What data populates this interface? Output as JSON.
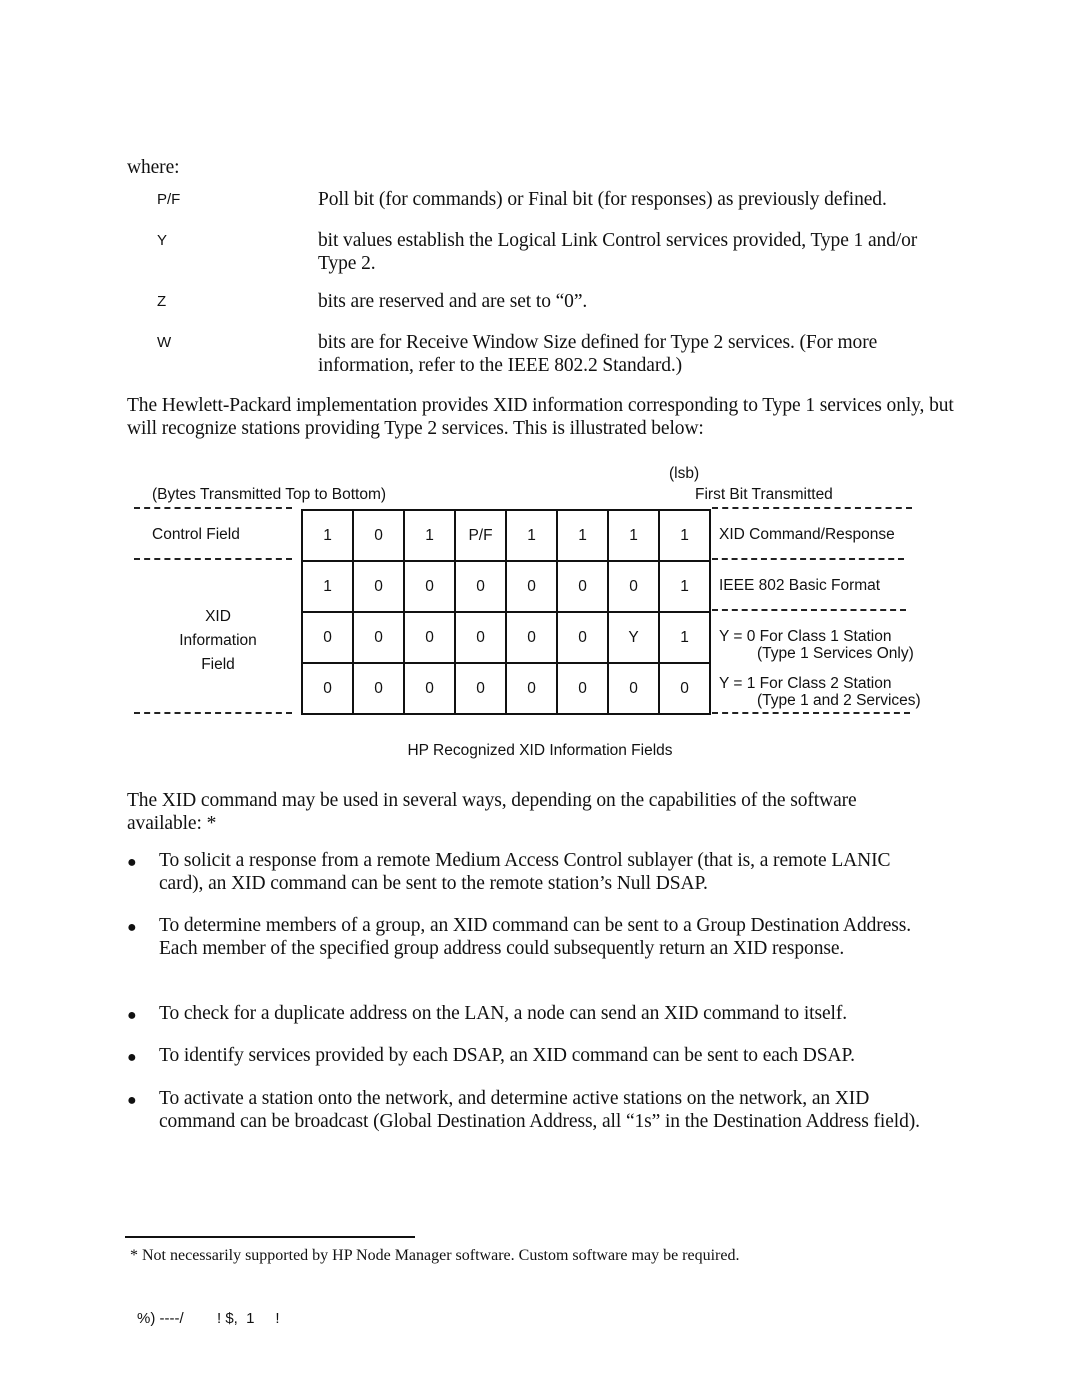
{
  "where_label": "where:",
  "definitions": [
    {
      "term": "P/F",
      "desc": "Poll bit (for commands) or Final bit (for responses) as previously defined."
    },
    {
      "term": "Y",
      "desc": "bit values establish the Logical Link Control services provided, Type 1 and/or Type 2."
    },
    {
      "term": "Z",
      "desc": "bits are reserved and are set to “0”."
    },
    {
      "term": "W",
      "desc": "bits are for Receive Window Size defined for Type 2 services. (For more information, refer to the IEEE 802.2 Standard.)"
    }
  ],
  "intro_paragraph": "The Hewlett-Packard implementation provides XID information corresponding to Type 1 services only, but will recognize stations providing Type 2 services.  This is illustrated below:",
  "diagram": {
    "bytes_order_label": "(Bytes Transmitted Top to Bottom)",
    "lsb_label": "(lsb)",
    "first_bit_label": "First Bit Transmitted",
    "control_field_label": "Control Field",
    "xid_info_label": [
      "XID",
      "Information",
      "Field"
    ],
    "rows": [
      {
        "bits": [
          "1",
          "0",
          "1",
          "P/F",
          "1",
          "1",
          "1",
          "1"
        ],
        "desc": "XID Command/Response"
      },
      {
        "bits": [
          "1",
          "0",
          "0",
          "0",
          "0",
          "0",
          "0",
          "1"
        ],
        "desc": "IEEE 802 Basic Format"
      },
      {
        "bits": [
          "0",
          "0",
          "0",
          "0",
          "0",
          "0",
          "Y",
          "1"
        ],
        "desc": "Y = 0 For Class 1 Station",
        "desc2": "(Type 1 Services Only)"
      },
      {
        "bits": [
          "0",
          "0",
          "0",
          "0",
          "0",
          "0",
          "0",
          "0"
        ],
        "desc": "Y = 1 For Class 2 Station",
        "desc2": "(Type 1 and 2 Services)"
      }
    ],
    "caption": "HP Recognized XID Information Fields"
  },
  "usage_paragraph": "The XID command may be used in several ways, depending on the capabilities of the software available: *",
  "bullets": [
    "To solicit a response from a remote Medium Access Control sublayer (that is, a remote LANIC card), an XID command can be sent to the remote station’s Null DSAP.",
    "To determine members of a group, an XID command can be sent to a Group Destination Address.  Each member of the specified group address could subsequently return an XID response.",
    "To check for a duplicate address on the LAN, a node can send an XID command to itself.",
    "To identify services provided by each DSAP, an XID command can be sent to each DSAP.",
    "To activate a station onto the network, and determine active stations on the network, an XID command can be broadcast (Global Destination Address, all “1s” in the Destination Address field)."
  ],
  "bullet_glyph": "●",
  "footnote": "* Not necessarily supported by HP Node Manager software.  Custom software may be required.",
  "page_footer": "%) ----/        ! $,  1     !"
}
